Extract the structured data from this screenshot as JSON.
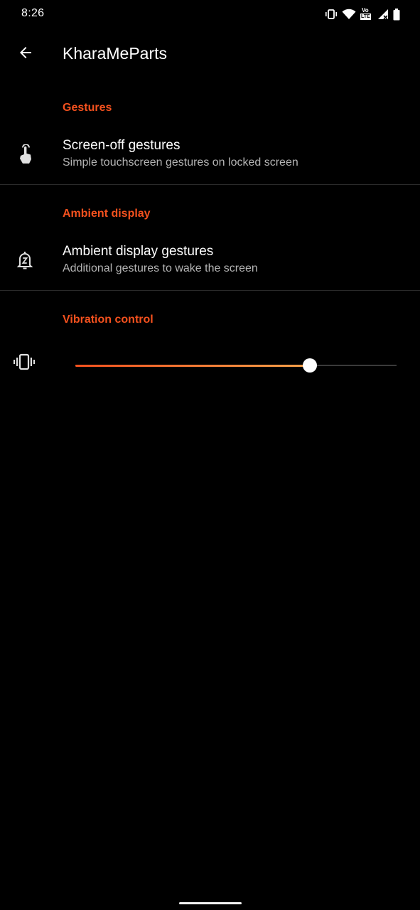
{
  "status_bar": {
    "time": "8:26",
    "icons": [
      "vibrate-icon",
      "wifi-icon",
      "volte-lte-icon",
      "signal-icon",
      "battery-icon"
    ],
    "volte_text": "Vo",
    "lte_text": "LTE"
  },
  "app_bar": {
    "title": "KharaMeParts",
    "back_icon": "arrow-back-icon"
  },
  "sections": {
    "gestures": {
      "header": "Gestures",
      "item": {
        "title": "Screen-off gestures",
        "summary": "Simple touchscreen gestures on locked screen",
        "icon": "touch-gesture-icon"
      }
    },
    "ambient": {
      "header": "Ambient display",
      "item": {
        "title": "Ambient display gestures",
        "summary": "Additional gestures to wake the screen",
        "icon": "ambient-bell-icon"
      }
    },
    "vibration": {
      "header": "Vibration control",
      "icon": "vibrate-icon",
      "slider_value_percent": 73
    }
  },
  "colors": {
    "accent": "#f4511e",
    "accent_light": "#f4a14a",
    "background": "#000000",
    "summary_text": "#b5b5b5"
  }
}
